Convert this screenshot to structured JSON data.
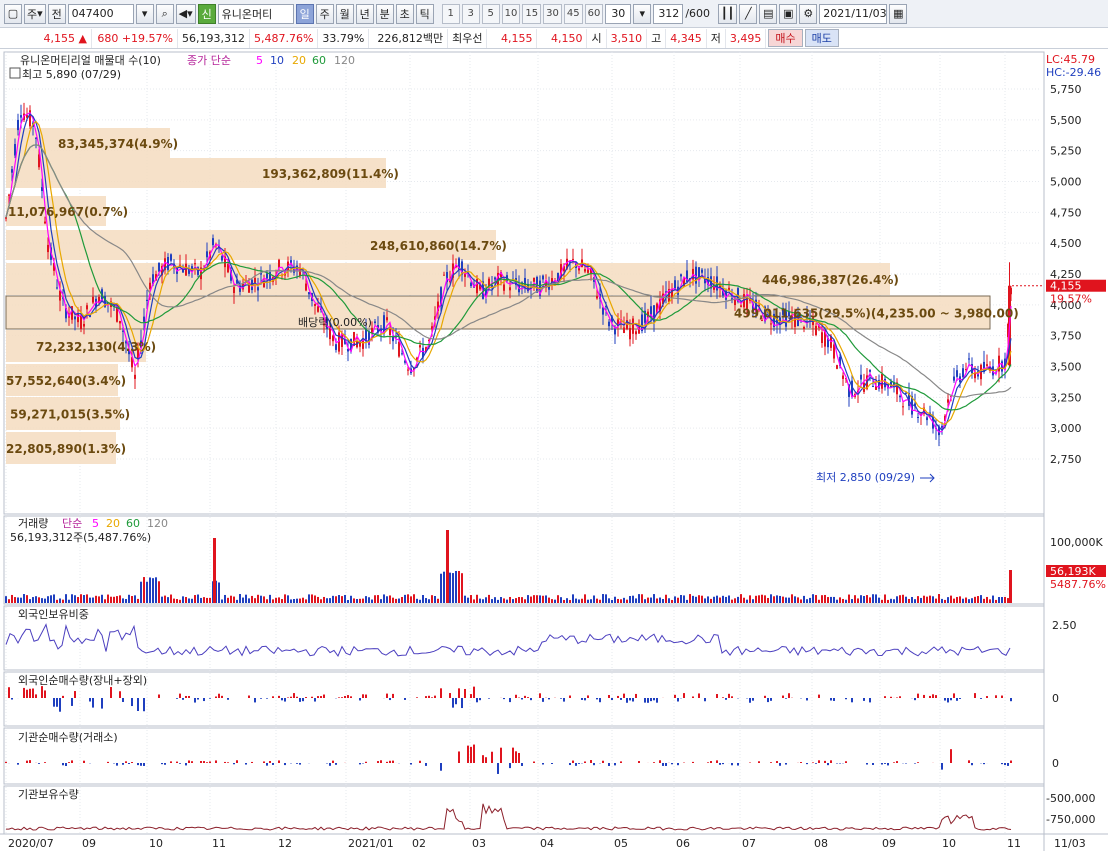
{
  "toolbar": {
    "period_unit": "주",
    "prev_label": "전",
    "code": "047400",
    "badge": "신",
    "stock_name": "유니온머티",
    "tabs": [
      "일",
      "주",
      "월",
      "년",
      "분",
      "초",
      "틱"
    ],
    "active_tab": "일",
    "ma_buttons": [
      "1",
      "3",
      "5",
      "10",
      "15",
      "30",
      "45",
      "60"
    ],
    "count_value": "30",
    "range_value": "312",
    "range_total": "/600",
    "date": "2021/11/03"
  },
  "quote": {
    "price": "4,155",
    "change": "680",
    "change_pct": "+19.57%",
    "volume": "56,193,312",
    "volume_ratio": "5,487.76%",
    "turnover_rate": "33.79%",
    "amount": "226,812백만",
    "best_ask_label": "최우선",
    "best_ask": "4,155",
    "best_bid": "4,150",
    "open_label": "시",
    "open": "3,510",
    "high_label": "고",
    "high": "4,345",
    "low_label": "저",
    "low": "3,495",
    "buy_label": "매수",
    "sell_label": "매도"
  },
  "price_panel": {
    "title": "유니온머티리얼 매물대 수(10)",
    "ma_label": "종가 단순",
    "ma_periods": [
      "5",
      "10",
      "20",
      "60",
      "120"
    ],
    "high_marker": "최고 5,890 (07/29)",
    "low_marker": "최저 2,850 (09/29)",
    "dividend_label": "배당락(0.00%)",
    "lc": "LC:45.79",
    "hc": "HC:-29.46",
    "current_price_tag": "4,155",
    "current_pct_tag": "19.57%",
    "y_ticks": [
      "5,750",
      "5,500",
      "5,250",
      "5,000",
      "4,750",
      "4,500",
      "4,250",
      "4,000",
      "3,750",
      "3,500",
      "3,250",
      "3,000",
      "2,750"
    ],
    "volume_profile": [
      {
        "label": "83,345,374(4.9%)"
      },
      {
        "label": "193,362,809(11.4%)"
      },
      {
        "label": "11,076,967(0.7%)"
      },
      {
        "label": "248,610,860(14.7%)"
      },
      {
        "label": "446,986,387(26.4%)"
      },
      {
        "label": "499,011,635(29.5%)(4,235.00 ~ 3,980.00)"
      },
      {
        "label": "72,232,130(4.3%)"
      },
      {
        "label": "57,552,640(3.4%)"
      },
      {
        "label": "59,271,015(3.5%)"
      },
      {
        "label": "22,805,890(1.3%)"
      }
    ]
  },
  "volume_panel": {
    "title": "거래량",
    "ma_label": "단순",
    "ma_periods": [
      "5",
      "20",
      "60",
      "120"
    ],
    "current": "56,193,312주(5,487.76%)",
    "y_tick": "100,000K",
    "tag_value": "56,193K",
    "tag_pct": "5487.76%"
  },
  "foreign_ratio_panel": {
    "title": "외국인보유비중",
    "y_tick": "2.50"
  },
  "foreign_net_panel": {
    "title": "외국인순매수량(장내+장외)",
    "y_tick": "0"
  },
  "inst_net_panel": {
    "title": "기관순매수량(거래소)",
    "y_tick": "0"
  },
  "inst_hold_panel": {
    "title": "기관보유수량",
    "y_ticks": [
      "-500,000",
      "-750,000"
    ]
  },
  "x_axis": [
    "2020/07",
    "09",
    "10",
    "11",
    "12",
    "2021/01",
    "02",
    "03",
    "04",
    "05",
    "06",
    "07",
    "08",
    "09",
    "10",
    "11",
    "11/03"
  ],
  "colors": {
    "up": "#e0141e",
    "down": "#1f3fbf",
    "ma5": "#ff00ff",
    "ma10": "#1f3fbf",
    "ma20": "#e8a800",
    "ma60": "#1f9a3a",
    "ma120": "#888888",
    "profile": "#f5dcc0"
  }
}
